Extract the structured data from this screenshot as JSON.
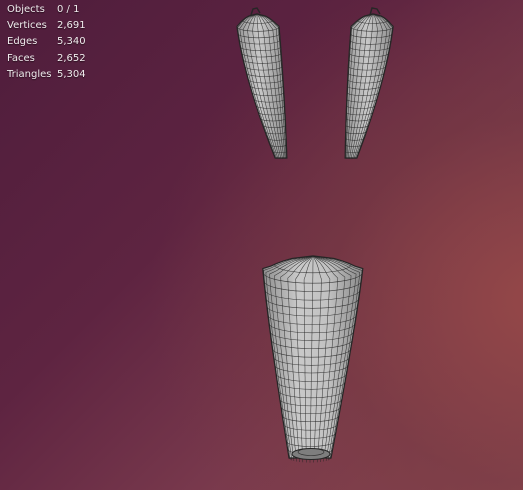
{
  "overlay": {
    "stats": [
      {
        "label": "Objects",
        "value": "0 / 1"
      },
      {
        "label": "Vertices",
        "value": "2,691"
      },
      {
        "label": "Edges",
        "value": "5,340"
      },
      {
        "label": "Faces",
        "value": "2,652"
      },
      {
        "label": "Triangles",
        "value": "5,304"
      }
    ]
  },
  "colors": {
    "mesh_fill": "#b9b9b9",
    "wire": "#262626",
    "text": "#f1ecee"
  }
}
